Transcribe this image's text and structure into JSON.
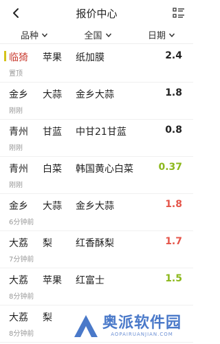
{
  "header": {
    "title": "报价中心",
    "back_icon": "chevron-left-icon",
    "menu_icon": "list-menu-icon"
  },
  "filters": [
    {
      "label": "品种",
      "icon": "chevron-down-icon"
    },
    {
      "label": "全国",
      "icon": "chevron-down-icon"
    },
    {
      "label": "日期",
      "icon": "chevron-down-icon"
    }
  ],
  "colors": {
    "up": "#e5554a",
    "down": "#8cb81c",
    "neutral": "#222222",
    "pinned": "#c83a2e"
  },
  "rows": [
    {
      "region": "临猗",
      "variety": "苹果",
      "product": "纸加膜",
      "time": "置顶",
      "price": "2.4",
      "color": "#222222",
      "pinned": true
    },
    {
      "region": "金乡",
      "variety": "大蒜",
      "product": "金乡大蒜",
      "time": "刚刚",
      "price": "1.8",
      "color": "#222222",
      "pinned": false
    },
    {
      "region": "青州",
      "variety": "甘蓝",
      "product": "中甘21甘蓝",
      "time": "刚刚",
      "price": "0.8",
      "color": "#222222",
      "pinned": false
    },
    {
      "region": "青州",
      "variety": "白菜",
      "product": "韩国黄心白菜",
      "time": "刚刚",
      "price": "0.37",
      "color": "#8cb81c",
      "pinned": false
    },
    {
      "region": "金乡",
      "variety": "大蒜",
      "product": "金乡大蒜",
      "time": "6分钟前",
      "price": "1.8",
      "color": "#e5554a",
      "pinned": false
    },
    {
      "region": "大荔",
      "variety": "梨",
      "product": "红香酥梨",
      "time": "7分钟前",
      "price": "1.7",
      "color": "#e5554a",
      "pinned": false
    },
    {
      "region": "大荔",
      "variety": "苹果",
      "product": "红富士",
      "time": "8分钟前",
      "price": "1.5",
      "color": "#8cb81c",
      "pinned": false
    },
    {
      "region": "大荔",
      "variety": "梨",
      "product": "",
      "time": "8分钟前",
      "price": "",
      "color": "#222222",
      "pinned": false
    }
  ],
  "watermark": {
    "name": "奥派软件园",
    "url": "AOPAIRUANJIAN.COM"
  }
}
